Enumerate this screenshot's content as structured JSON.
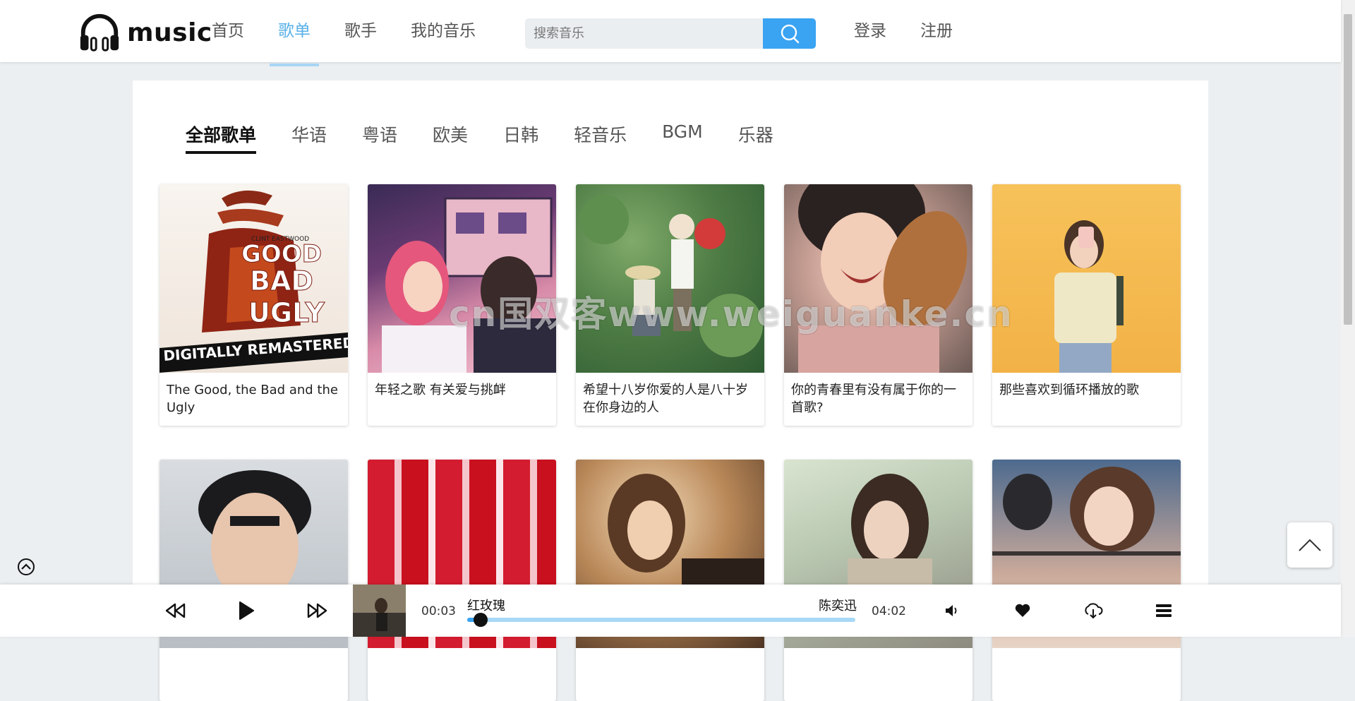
{
  "app": {
    "logo_text": "music"
  },
  "nav": [
    {
      "label": "首页",
      "active": false
    },
    {
      "label": "歌单",
      "active": true
    },
    {
      "label": "歌手",
      "active": false
    },
    {
      "label": "我的音乐",
      "active": false
    }
  ],
  "search": {
    "placeholder": "搜索音乐",
    "value": ""
  },
  "auth": {
    "login": "登录",
    "register": "注册"
  },
  "categories": [
    {
      "label": "全部歌单",
      "active": true
    },
    {
      "label": "华语",
      "active": false
    },
    {
      "label": "粤语",
      "active": false
    },
    {
      "label": "欧美",
      "active": false
    },
    {
      "label": "日韩",
      "active": false
    },
    {
      "label": "轻音乐",
      "active": false
    },
    {
      "label": "BGM",
      "active": false
    },
    {
      "label": "乐器",
      "active": false
    }
  ],
  "playlists": [
    {
      "title": "The Good, the Bad and the Ugly",
      "cover_text_top": "CLINT EASTWOOD",
      "cover_text_main": "GOOD BAD UGLY",
      "cover_text_banner": "DIGITALLY REMASTERED"
    },
    {
      "title": "年轻之歌 有关爱与挑衅"
    },
    {
      "title": "希望十八岁你爱的人是八十岁在你身边的人"
    },
    {
      "title": "你的青春里有没有属于你的一首歌?"
    },
    {
      "title": "那些喜欢到循环播放的歌"
    },
    {
      "title": ""
    },
    {
      "title": ""
    },
    {
      "title": ""
    },
    {
      "title": ""
    },
    {
      "title": ""
    }
  ],
  "watermark": "cn国双客www.weiguanke.cn",
  "player": {
    "current_time": "00:03",
    "duration": "04:02",
    "song": "红玫瑰",
    "artist": "陈奕迅",
    "progress": 0.035
  },
  "colors": {
    "accent": "#3aa3f2",
    "nav_active": "#5ab1e8",
    "progress_track": "#a8d8f5"
  },
  "icons": [
    "headphones-logo-icon",
    "search-icon",
    "prev-icon",
    "play-icon",
    "next-icon",
    "volume-icon",
    "heart-icon",
    "download-icon",
    "playlist-menu-icon",
    "back-to-top-icon",
    "collapse-player-icon"
  ]
}
